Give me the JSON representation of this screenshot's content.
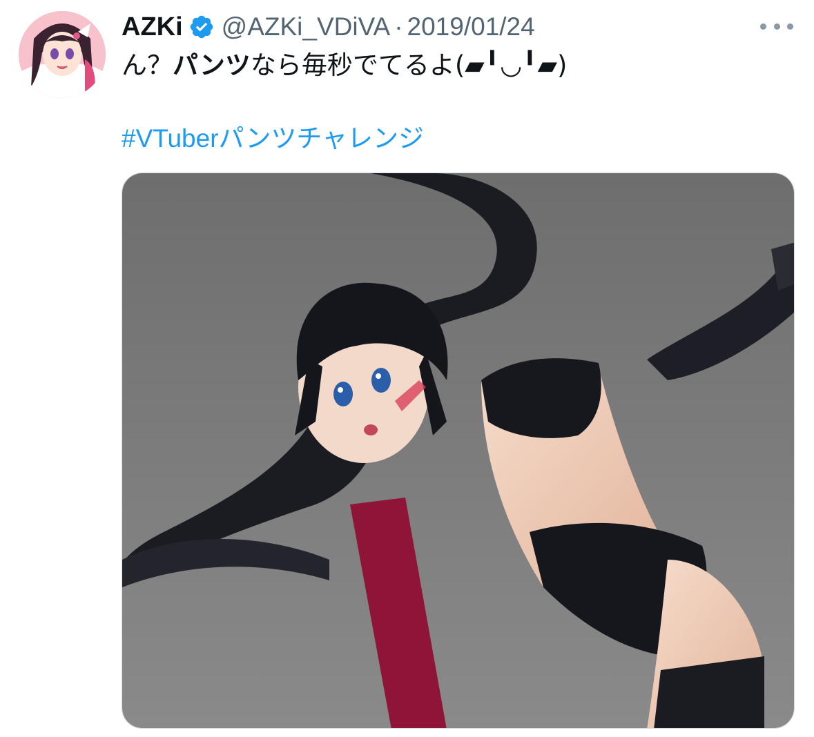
{
  "tweet": {
    "display_name": "AZKi",
    "handle": "@AZKi_VDiVA",
    "separator": "·",
    "date": "2019/01/24",
    "text_before": "ん？",
    "text_bold": "パンツ",
    "text_after": "なら毎秒でてるよ(▰╹◡╹▰)",
    "hashtag": "#VTuberパンツチャレンジ"
  },
  "icons": {
    "verified": "verified-badge-icon",
    "more": "more-options-icon"
  },
  "colors": {
    "hashtag": "#1d9bf0",
    "verified": "#1d9bf0",
    "muted": "#536471",
    "media_background": "#7c7c7c"
  }
}
